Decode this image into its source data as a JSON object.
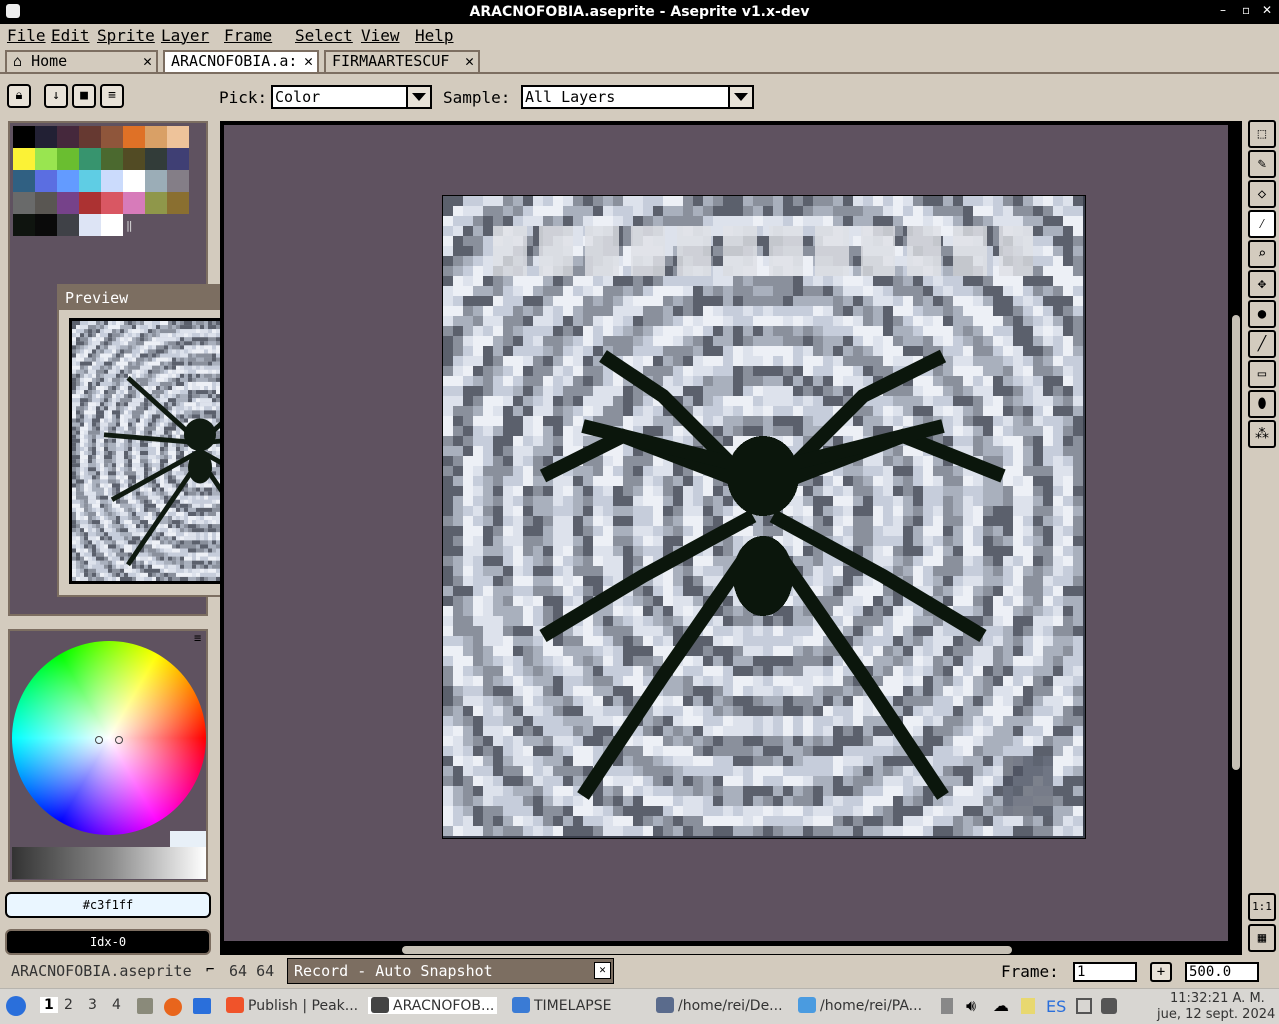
{
  "window": {
    "title": "ARACNOFOBIA.aseprite - Aseprite v1.x-dev"
  },
  "menu": [
    "File",
    "Edit",
    "Sprite",
    "Layer",
    "Frame",
    "Select",
    "View",
    "Help"
  ],
  "tabs": [
    {
      "label": "Home",
      "icon": "home-icon",
      "active": false
    },
    {
      "label": "ARACNOFOBIA.a:",
      "active": true
    },
    {
      "label": "FIRMAARTESCUF",
      "active": false
    }
  ],
  "toolbar": {
    "pick_label": "Pick:",
    "pick_value": "Color",
    "sample_label": "Sample:",
    "sample_value": "All Layers"
  },
  "palette": [
    "#000000",
    "#222034",
    "#45283c",
    "#663931",
    "#8f563b",
    "#df7126",
    "#d9a066",
    "#eec39a",
    "#fbf236",
    "#99e550",
    "#6abe30",
    "#37946e",
    "#4b692f",
    "#524b24",
    "#323c39",
    "#3f3f74",
    "#306082",
    "#5b6ee1",
    "#639bff",
    "#5fcde4",
    "#cbdbfc",
    "#ffffff",
    "#9badb7",
    "#847e87",
    "#696a6a",
    "#595652",
    "#76428a",
    "#ac3232",
    "#d95763",
    "#d77bba",
    "#8f974a",
    "#8a6f30",
    "#0f140f",
    "#0a0a0a",
    "#3f4147",
    "#dde4f5",
    "#ffffff"
  ],
  "preview": {
    "title": "Preview"
  },
  "color": {
    "hex": "#c3f1ff",
    "index": "Idx-0"
  },
  "status": {
    "filename": "ARACNOFOBIA.aseprite",
    "size": "64 64",
    "record": "Record - Auto Snapshot",
    "frame_label": "Frame:",
    "frame_value": "1",
    "zoom": "500.0"
  },
  "tools_bottom": {
    "one_to_one": "1:1"
  },
  "taskbar": {
    "workspaces": [
      "1",
      "2",
      "3",
      "4"
    ],
    "apps": [
      {
        "label": "Publish | Peak...",
        "color": "#f0532a"
      },
      {
        "label": "ARACNOFOB...",
        "color": "#444444"
      },
      {
        "label": "TIMELAPSE",
        "color": "#3a7bd5"
      },
      {
        "label": "/home/rei/De...",
        "color": "#5a6b8c"
      },
      {
        "label": "/home/rei/PA...",
        "color": "#4a9be0"
      }
    ],
    "lang": "ES",
    "clock_time": "11:32:21 A. M.",
    "clock_date": "jue, 12 sept. 2024"
  }
}
